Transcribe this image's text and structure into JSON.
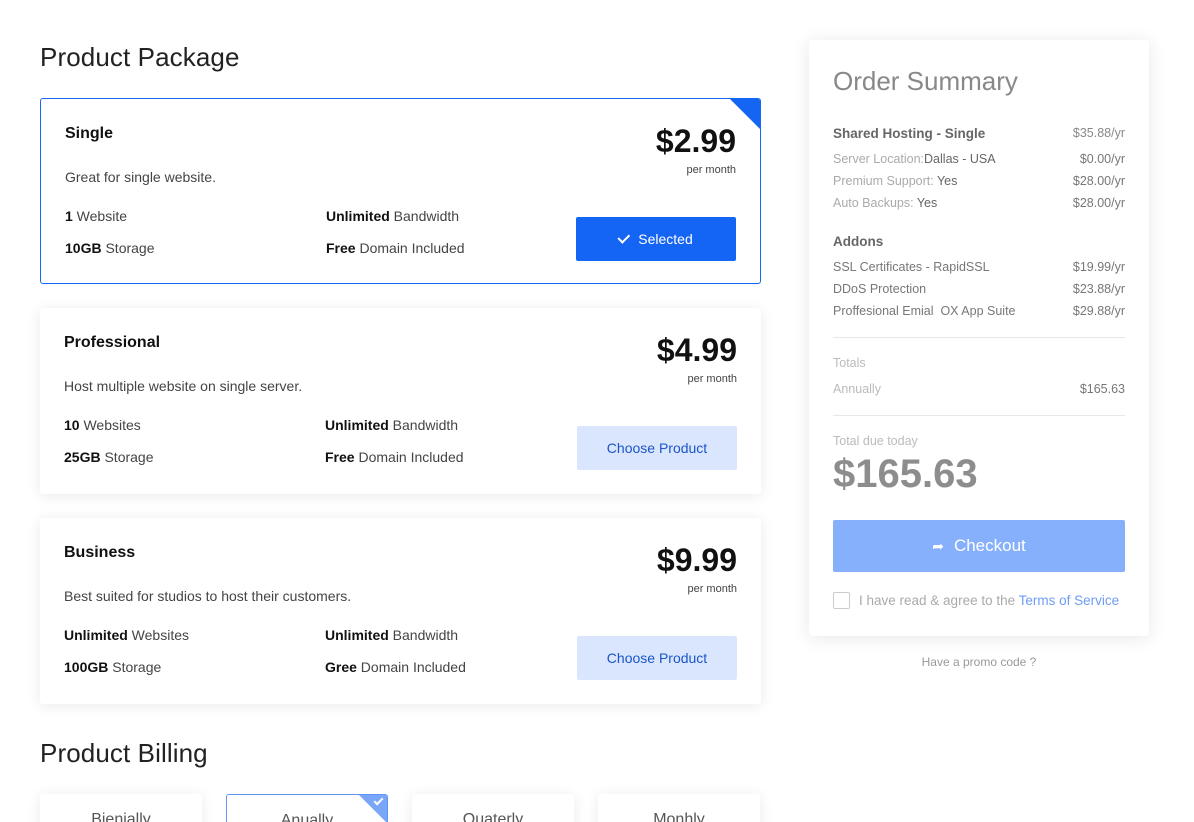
{
  "page": {
    "package_title": "Product Package",
    "billing_title": "Product Billing"
  },
  "packages": [
    {
      "name": "Single",
      "description": "Great for single website.",
      "price": "$2.99",
      "per": "per month",
      "features": [
        {
          "bold": "1",
          "text": " Website"
        },
        {
          "bold": "Unlimited",
          "text": " Bandwidth"
        },
        {
          "bold": "10GB",
          "text": " Storage"
        },
        {
          "bold": "Free",
          "text": " Domain Included"
        }
      ],
      "button": "Selected",
      "selected": true
    },
    {
      "name": "Professional",
      "description": "Host multiple website on single server.",
      "price": "$4.99",
      "per": "per month",
      "features": [
        {
          "bold": "10",
          "text": " Websites"
        },
        {
          "bold": "Unlimited",
          "text": " Bandwidth"
        },
        {
          "bold": "25GB",
          "text": " Storage"
        },
        {
          "bold": "Free",
          "text": " Domain Included"
        }
      ],
      "button": "Choose Product",
      "selected": false
    },
    {
      "name": "Business",
      "description": "Best suited for studios to host their customers.",
      "price": "$9.99",
      "per": "per month",
      "features": [
        {
          "bold": "Unlimited",
          "text": " Websites"
        },
        {
          "bold": "Unlimited",
          "text": " Bandwidth"
        },
        {
          "bold": "100GB",
          "text": " Storage"
        },
        {
          "bold": "Gree",
          "text": " Domain Included"
        }
      ],
      "button": "Choose Product",
      "selected": false
    }
  ],
  "billing": {
    "options": [
      "Bienially",
      "Anually",
      "Quaterly",
      "Monhly"
    ],
    "selected": "Anually"
  },
  "summary": {
    "title": "Order Summary",
    "plan": {
      "label": "Shared Hosting - Single",
      "value": "$35.88/yr"
    },
    "options": [
      {
        "label": "Server Location:",
        "detail": "Dallas - USA",
        "value": "$0.00/yr"
      },
      {
        "label": "Premium Support: ",
        "detail": "Yes",
        "value": "$28.00/yr"
      },
      {
        "label": "Auto Backups: ",
        "detail": "Yes",
        "value": "$28.00/yr"
      }
    ],
    "addons_title": "Addons",
    "addons": [
      {
        "label": "SSL Certificates - RapidSSL",
        "value": "$19.99/yr"
      },
      {
        "label": "DDoS Protection",
        "value": "$23.88/yr"
      },
      {
        "label": "Proffesional Emial  OX App Suite",
        "value": "$29.88/yr"
      }
    ],
    "totals_label": "Totals",
    "annually_label": "Annually",
    "annually_value": "$165.63",
    "due_label": "Total due today",
    "due_value": "$165.63",
    "checkout_label": "Checkout",
    "agree_text": "I have read & agree to the ",
    "tos_link": "Terms of Service",
    "promo": "Have a promo code ?"
  },
  "colors": {
    "primary": "#1565f5",
    "choose_bg": "#d9e6fd",
    "checkout_bg": "#86b0fb"
  }
}
